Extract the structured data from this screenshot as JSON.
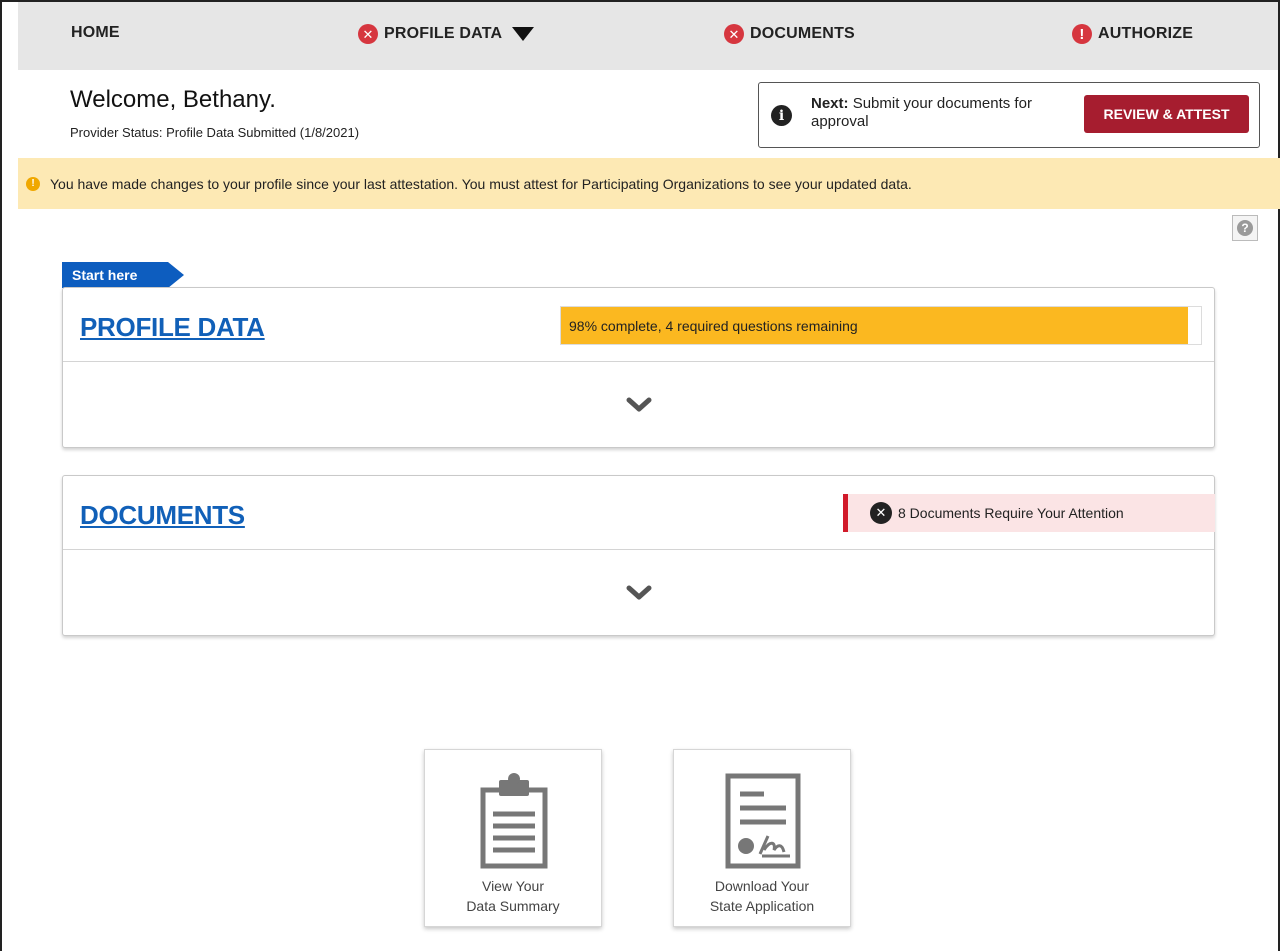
{
  "nav": {
    "home": "HOME",
    "profile_data": "PROFILE DATA",
    "documents": "DOCUMENTS",
    "authorize": "AUTHORIZE"
  },
  "header": {
    "welcome": "Welcome, Bethany.",
    "status": "Provider Status:  Profile Data Submitted (1/8/2021)"
  },
  "next": {
    "label": "Next:",
    "text": "Submit your documents for approval",
    "button": "REVIEW & ATTEST"
  },
  "alert": {
    "text": "You have made changes to your profile since your last attestation. You must attest for Participating Organizations to see your updated data."
  },
  "start_tag": "Start here",
  "profile_card": {
    "title": "PROFILE DATA",
    "progress_percent": 98,
    "progress_label": "98% complete, 4 required questions remaining"
  },
  "documents_card": {
    "title": "DOCUMENTS",
    "attention": "8 Documents Require Your Attention"
  },
  "tiles": [
    {
      "line1": "View Your",
      "line2": "Data Summary",
      "icon": "clipboard-icon"
    },
    {
      "line1": "Download Your",
      "line2": "State Application",
      "icon": "certificate-icon"
    }
  ],
  "colors": {
    "accent_blue": "#1160b8",
    "tag_blue": "#0d5dbf",
    "error_red": "#d6363f",
    "button_red": "#a61d2f",
    "progress_yellow": "#fbb820",
    "alert_bg": "#fde9b4"
  }
}
